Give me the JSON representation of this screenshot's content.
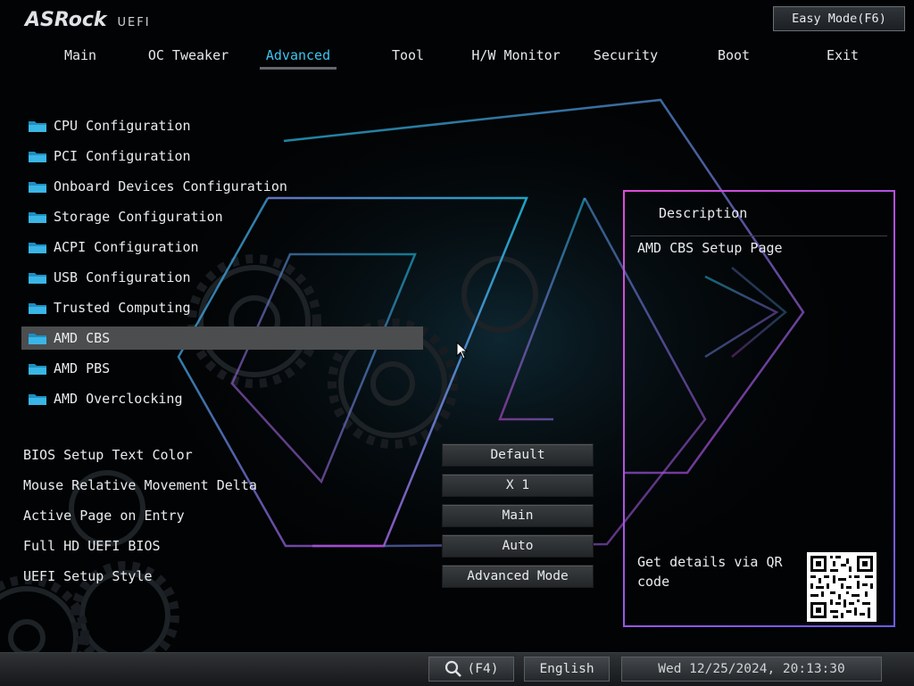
{
  "header": {
    "brand": "ASRock",
    "product": "UEFI",
    "easy_mode_label": "Easy Mode(F6)"
  },
  "tabs": [
    {
      "label": "Main",
      "active": false
    },
    {
      "label": "OC Tweaker",
      "active": false
    },
    {
      "label": "Advanced",
      "active": true
    },
    {
      "label": "Tool",
      "active": false
    },
    {
      "label": "H/W Monitor",
      "active": false
    },
    {
      "label": "Security",
      "active": false
    },
    {
      "label": "Boot",
      "active": false
    },
    {
      "label": "Exit",
      "active": false
    }
  ],
  "menu": [
    {
      "label": "CPU Configuration",
      "icon": "folder-icon",
      "selected": false
    },
    {
      "label": "PCI Configuration",
      "icon": "folder-icon",
      "selected": false
    },
    {
      "label": "Onboard Devices Configuration",
      "icon": "folder-icon",
      "selected": false
    },
    {
      "label": "Storage Configuration",
      "icon": "folder-icon",
      "selected": false
    },
    {
      "label": "ACPI Configuration",
      "icon": "folder-icon",
      "selected": false
    },
    {
      "label": "USB Configuration",
      "icon": "folder-icon",
      "selected": false
    },
    {
      "label": "Trusted Computing",
      "icon": "folder-icon",
      "selected": false
    },
    {
      "label": "AMD CBS",
      "icon": "folder-icon",
      "selected": true
    },
    {
      "label": "AMD PBS",
      "icon": "folder-icon",
      "selected": false
    },
    {
      "label": "AMD Overclocking",
      "icon": "folder-icon",
      "selected": false
    }
  ],
  "settings": [
    {
      "label": "BIOS Setup Text Color",
      "value": "Default"
    },
    {
      "label": "Mouse Relative Movement Delta",
      "value": "X 1"
    },
    {
      "label": "Active Page on Entry",
      "value": "Main"
    },
    {
      "label": "Full HD UEFI BIOS",
      "value": "Auto"
    },
    {
      "label": "UEFI Setup Style",
      "value": "Advanced Mode"
    }
  ],
  "description": {
    "title": "Description",
    "text": "AMD CBS Setup Page",
    "qr_text": "Get details via QR code"
  },
  "footer": {
    "search_label": "(F4)",
    "search_icon": "magnifier-icon",
    "language": "English",
    "datetime": "Wed 12/25/2024, 20:13:30"
  },
  "colors": {
    "accent_tab": "#3ec4ef",
    "folder_icon": "#3ab6e6",
    "selected_row": "#4b4d4f",
    "panel_border_start": "#e04bd8",
    "panel_border_end": "#6a5cf0"
  }
}
